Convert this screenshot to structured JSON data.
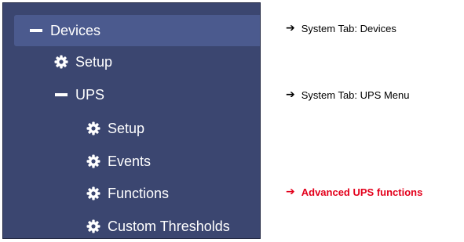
{
  "nav": {
    "devices": {
      "label": "Devices",
      "icon": "minus-icon"
    },
    "setup": {
      "label": "Setup",
      "icon": "gear-icon"
    },
    "ups": {
      "label": "UPS",
      "icon": "minus-icon"
    },
    "ups_setup": {
      "label": "Setup",
      "icon": "gear-icon"
    },
    "events": {
      "label": "Events",
      "icon": "gear-icon"
    },
    "functions": {
      "label": "Functions",
      "icon": "gear-icon"
    },
    "custom_thresholds": {
      "label": "Custom Thresholds",
      "icon": "gear-icon"
    }
  },
  "annotations": {
    "devices": {
      "arrow": "➔",
      "text": "System Tab: Devices"
    },
    "ups_menu": {
      "arrow": "➔",
      "text": "System Tab: UPS Menu"
    },
    "advanced": {
      "arrow": "➔",
      "text": "Advanced UPS functions",
      "color": "#e3001b"
    }
  },
  "colors": {
    "panel_bg": "#3b4670",
    "selected_bg": "#4b5a8e"
  }
}
